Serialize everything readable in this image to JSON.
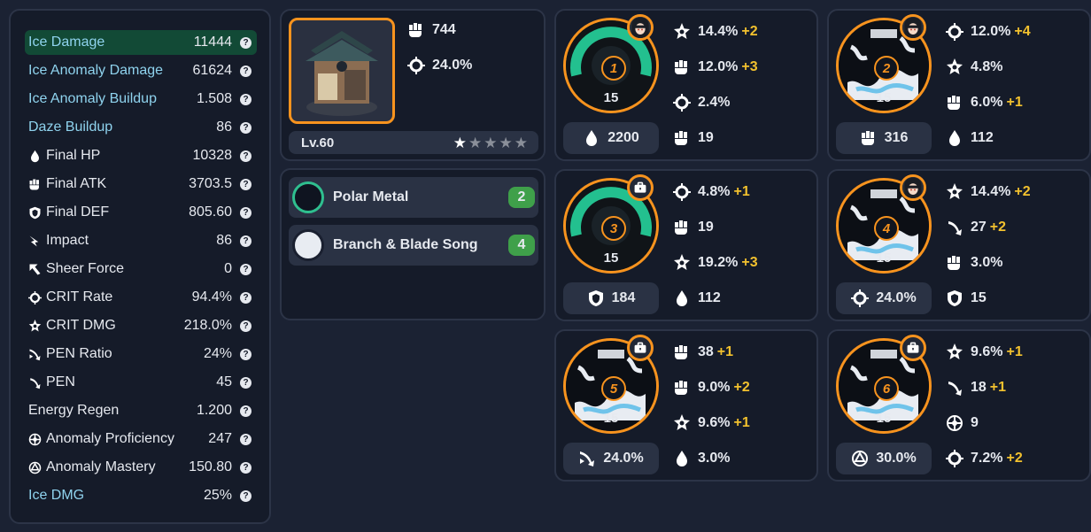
{
  "stats": [
    {
      "label": "Ice Damage",
      "value": "11444",
      "icon": "",
      "blue": true,
      "highlight": true
    },
    {
      "label": "Ice Anomaly Damage",
      "value": "61624",
      "icon": "",
      "blue": true
    },
    {
      "label": "Ice Anomaly Buildup",
      "value": "1.508",
      "icon": "",
      "blue": true
    },
    {
      "label": "Daze Buildup",
      "value": "86",
      "icon": "",
      "blue": true
    },
    {
      "label": "Final HP",
      "value": "10328",
      "icon": "hp-icon"
    },
    {
      "label": "Final ATK",
      "value": "3703.5",
      "icon": "atk-icon"
    },
    {
      "label": "Final DEF",
      "value": "805.60",
      "icon": "def-icon"
    },
    {
      "label": "Impact",
      "value": "86",
      "icon": "impact-icon"
    },
    {
      "label": "Sheer Force",
      "value": "0",
      "icon": "sheer-force-icon"
    },
    {
      "label": "CRIT Rate",
      "value": "94.4%",
      "icon": "crit-rate-icon"
    },
    {
      "label": "CRIT DMG",
      "value": "218.0%",
      "icon": "crit-dmg-icon"
    },
    {
      "label": "PEN Ratio",
      "value": "24%",
      "icon": "pen-ratio-icon"
    },
    {
      "label": "PEN",
      "value": "45",
      "icon": "pen-icon"
    },
    {
      "label": "Energy Regen",
      "value": "1.200",
      "icon": ""
    },
    {
      "label": "Anomaly Proficiency",
      "value": "247",
      "icon": "anomaly-proficiency-icon"
    },
    {
      "label": "Anomaly Mastery",
      "value": "150.80",
      "icon": "anomaly-mastery-icon"
    },
    {
      "label": "Ice DMG",
      "value": "25%",
      "icon": "",
      "blue": true
    }
  ],
  "weapon": {
    "base_atk": "744",
    "sub_stat": "24.0%",
    "level": "Lv.60",
    "stars": 1,
    "stars_max": 5
  },
  "sets": [
    {
      "name": "Polar Metal",
      "count": "2"
    },
    {
      "name": "Branch & Blade Song",
      "count": "4"
    }
  ],
  "discs": [
    {
      "slot": "1",
      "level": "15",
      "main": {
        "icon": "hp-icon",
        "value": "2200"
      },
      "subs": [
        {
          "icon": "crit-dmg-icon",
          "value": "14.4%",
          "up": "+2"
        },
        {
          "icon": "atk-icon",
          "value": "12.0%",
          "up": "+3"
        },
        {
          "icon": "crit-rate-icon",
          "value": "2.4%",
          "up": ""
        },
        {
          "icon": "atk-icon",
          "value": "19",
          "up": ""
        }
      ]
    },
    {
      "slot": "2",
      "level": "15",
      "main": {
        "icon": "atk-icon",
        "value": "316"
      },
      "subs": [
        {
          "icon": "crit-rate-icon",
          "value": "12.0%",
          "up": "+4"
        },
        {
          "icon": "crit-dmg-icon",
          "value": "4.8%",
          "up": ""
        },
        {
          "icon": "atk-icon",
          "value": "6.0%",
          "up": "+1"
        },
        {
          "icon": "hp-icon",
          "value": "112",
          "up": ""
        }
      ]
    },
    {
      "slot": "3",
      "level": "15",
      "main": {
        "icon": "def-icon",
        "value": "184"
      },
      "subs": [
        {
          "icon": "crit-rate-icon",
          "value": "4.8%",
          "up": "+1"
        },
        {
          "icon": "atk-icon",
          "value": "19",
          "up": ""
        },
        {
          "icon": "crit-dmg-icon",
          "value": "19.2%",
          "up": "+3"
        },
        {
          "icon": "hp-icon",
          "value": "112",
          "up": ""
        }
      ]
    },
    {
      "slot": "4",
      "level": "15",
      "main": {
        "icon": "crit-rate-icon",
        "value": "24.0%"
      },
      "subs": [
        {
          "icon": "crit-dmg-icon",
          "value": "14.4%",
          "up": "+2"
        },
        {
          "icon": "pen-icon",
          "value": "27",
          "up": "+2"
        },
        {
          "icon": "atk-icon",
          "value": "3.0%",
          "up": ""
        },
        {
          "icon": "def-icon",
          "value": "15",
          "up": ""
        }
      ]
    },
    {
      "slot": "5",
      "level": "15",
      "main": {
        "icon": "pen-ratio-icon",
        "value": "24.0%"
      },
      "subs": [
        {
          "icon": "atk-icon",
          "value": "38",
          "up": "+1"
        },
        {
          "icon": "atk-icon",
          "value": "9.0%",
          "up": "+2"
        },
        {
          "icon": "crit-dmg-icon",
          "value": "9.6%",
          "up": "+1"
        },
        {
          "icon": "hp-icon",
          "value": "3.0%",
          "up": ""
        }
      ]
    },
    {
      "slot": "6",
      "level": "15",
      "main": {
        "icon": "anomaly-mastery-icon",
        "value": "30.0%"
      },
      "subs": [
        {
          "icon": "crit-dmg-icon",
          "value": "9.6%",
          "up": "+1"
        },
        {
          "icon": "pen-icon",
          "value": "18",
          "up": "+1"
        },
        {
          "icon": "anomaly-proficiency-icon",
          "value": "9",
          "up": ""
        },
        {
          "icon": "crit-rate-icon",
          "value": "7.2%",
          "up": "+2"
        }
      ]
    }
  ]
}
